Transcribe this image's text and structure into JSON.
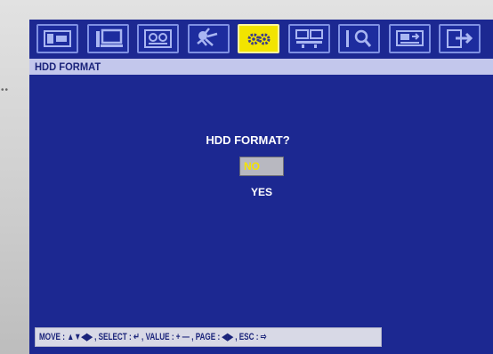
{
  "colors": {
    "screen_bg": "#1c2891",
    "toolbar_icon_border": "#7f90e2",
    "active_icon_bg": "#f2e400",
    "title_bar_bg": "#c3c7ec",
    "title_text": "#1a237a",
    "option_highlight_bg": "#b8b8c0",
    "option_highlight_text": "#f4e300",
    "help_bar_bg": "#d8d9e6"
  },
  "toolbar": {
    "icons": [
      {
        "name": "display-setup-icon",
        "active": false
      },
      {
        "name": "monitor-icon",
        "active": false
      },
      {
        "name": "record-icon",
        "active": false
      },
      {
        "name": "motion-detect-icon",
        "active": false
      },
      {
        "name": "system-settings-icon",
        "active": true
      },
      {
        "name": "network-icon",
        "active": false
      },
      {
        "name": "search-icon",
        "active": false
      },
      {
        "name": "backup-icon",
        "active": false
      },
      {
        "name": "exit-icon",
        "active": false
      }
    ]
  },
  "menu": {
    "title": "HDD FORMAT"
  },
  "dialog": {
    "question": "HDD FORMAT?",
    "options": [
      {
        "label": "NO",
        "selected": true
      },
      {
        "label": "YES",
        "selected": false
      }
    ]
  },
  "help": {
    "text": "MOVE : ▲▼◀▶ , SELECT : ↵ , VALUE : + — , PAGE : ◀▶ , ESC : ⇨"
  }
}
